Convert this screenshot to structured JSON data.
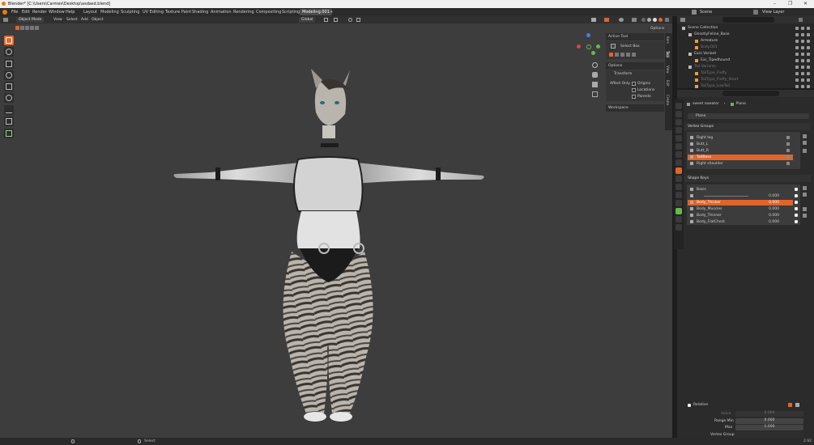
{
  "window": {
    "title": "Blender* [C:\\Users\\Carmes\\Desktop\\asdasd.blend]",
    "controls": [
      "–",
      "❐",
      "✕"
    ]
  },
  "menu": {
    "items": [
      "File",
      "Edit",
      "Render",
      "Window",
      "Help"
    ]
  },
  "workspaces": {
    "tabs": [
      "Layout",
      "Modeling",
      "Sculpting",
      "UV Editing",
      "Texture Paint",
      "Shading",
      "Animation",
      "Rendering",
      "Compositing",
      "Scripting",
      "Modeling.001"
    ],
    "active": "Modeling.001",
    "add": "+"
  },
  "scene": {
    "label": "Scene",
    "view_layer": "View Layer"
  },
  "viewport_header": {
    "mode": "Object Mode",
    "menus": [
      "View",
      "Select",
      "Add",
      "Object"
    ],
    "orientation": "Global",
    "options": "Options"
  },
  "npanel": {
    "active_tool": "Active Tool",
    "select_box": "Select Box",
    "options": "Options",
    "transform": "Transform",
    "affect_only": "Affect Only",
    "origins": "Origins",
    "locations": "Locations",
    "parents": "Parents",
    "workspace": "Workspace"
  },
  "vtabs": [
    "Item",
    "Tool",
    "View",
    "Edit",
    "Create"
  ],
  "outliner": {
    "rows": [
      {
        "name": "Scene Collection",
        "indent": 0,
        "dim": false
      },
      {
        "name": "GhostlyFeline_Base",
        "indent": 1,
        "dim": false
      },
      {
        "name": "Armature",
        "indent": 2,
        "dim": false
      },
      {
        "name": "Body.001",
        "indent": 2,
        "dim": true
      },
      {
        "name": "Ears Variant",
        "indent": 1,
        "dim": false
      },
      {
        "name": "Ear_Tipedhound",
        "indent": 2,
        "dim": false
      },
      {
        "name": "Tail Variants",
        "indent": 1,
        "dim": true
      },
      {
        "name": "TailType_Fluffy",
        "indent": 2,
        "dim": true
      },
      {
        "name": "TailType_Fluffy_Short",
        "indent": 2,
        "dim": true
      },
      {
        "name": "TailType_LowTail",
        "indent": 2,
        "dim": true
      }
    ]
  },
  "properties": {
    "breadcrumb_object": "sweet sweater",
    "breadcrumb_mesh": "Plane",
    "mesh_name": "Plane",
    "vertex_groups_title": "Vertex Groups",
    "vertex_groups": [
      {
        "name": "Right leg",
        "selected": false
      },
      {
        "name": "Butt_L",
        "selected": false
      },
      {
        "name": "Butt_R",
        "selected": false
      },
      {
        "name": "TailBase",
        "selected": true
      },
      {
        "name": "Right shoulder",
        "selected": false
      }
    ],
    "shape_keys_title": "Shape Keys",
    "shape_keys": [
      {
        "name": "Basis",
        "value": "",
        "selected": false
      },
      {
        "name": "",
        "value": "0.000",
        "selected": false
      },
      {
        "name": "Body_Thicker",
        "value": "0.000",
        "selected": true
      },
      {
        "name": "Body_Muscles",
        "value": "0.000",
        "selected": false
      },
      {
        "name": "Body_Thinner",
        "value": "0.000",
        "selected": false
      },
      {
        "name": "Body_FlatChest",
        "value": "0.000",
        "selected": false
      }
    ],
    "relative": "Relative",
    "value_label": "Value",
    "value": "0.000",
    "range_min_label": "Range Min",
    "range_min": "0.000",
    "max_label": "Max",
    "max": "1.000",
    "vertex_group_label": "Vertex Group"
  },
  "status": {
    "select": "Select",
    "version": "2.92"
  },
  "colors": {
    "accent": "#e0642b",
    "viewport_bg": "#3d3d3d"
  }
}
